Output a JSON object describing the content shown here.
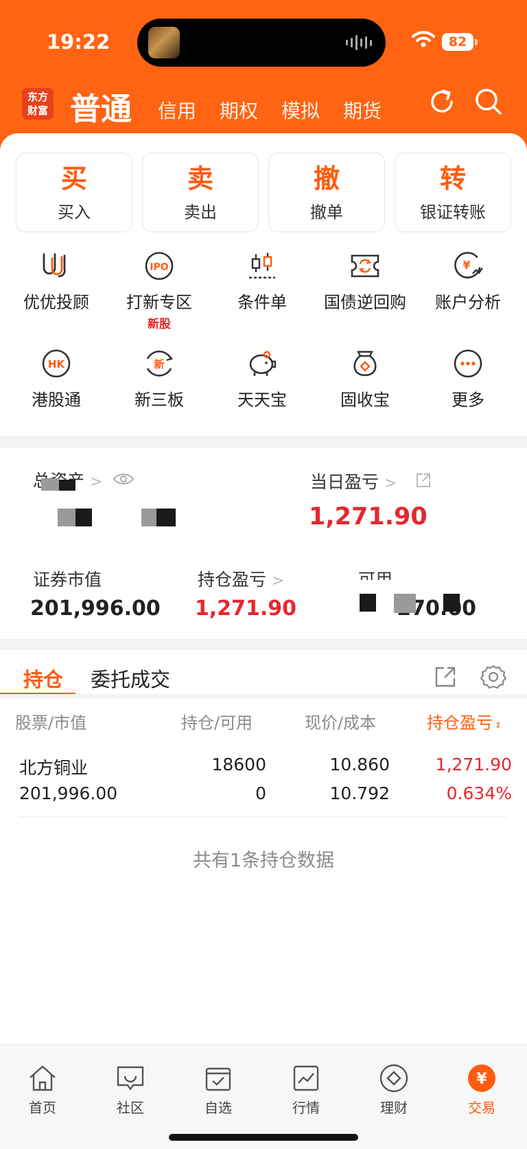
{
  "status": {
    "time": "19:22",
    "battery": "82"
  },
  "header": {
    "logo": [
      "东方",
      "财富"
    ],
    "active_tab": "普通",
    "tabs": [
      "信用",
      "期权",
      "模拟",
      "期货"
    ],
    "icons": [
      "refresh-icon",
      "search-icon"
    ]
  },
  "trade_buttons": [
    {
      "big": "买",
      "label": "买入"
    },
    {
      "big": "卖",
      "label": "卖出"
    },
    {
      "big": "撤",
      "label": "撤单"
    },
    {
      "big": "转",
      "label": "银证转账"
    }
  ],
  "grid_row1": [
    {
      "label": "优优投顾",
      "icon": "uu-advisor-icon"
    },
    {
      "label": "打新专区",
      "icon": "ipo-icon",
      "badge": "新股"
    },
    {
      "label": "条件单",
      "icon": "candlestick-icon"
    },
    {
      "label": "国债逆回购",
      "icon": "repo-ticket-icon"
    },
    {
      "label": "账户分析",
      "icon": "account-analysis-icon"
    }
  ],
  "grid_row2": [
    {
      "label": "港股通",
      "icon": "hk-icon"
    },
    {
      "label": "新三板",
      "icon": "new-board-icon"
    },
    {
      "label": "天天宝",
      "icon": "piggy-bank-icon"
    },
    {
      "label": "固收宝",
      "icon": "money-bag-icon"
    },
    {
      "label": "更多",
      "icon": "more-icon"
    }
  ],
  "assets": {
    "total_label": "总资产",
    "daily_pnl_label": "当日盈亏",
    "daily_pnl_value": "1,271.90",
    "market_value_label": "证券市值",
    "market_value": "201,996.00",
    "position_pnl_label": "持仓盈亏",
    "position_pnl_value": "1,271.90",
    "available_label": "可用",
    "available_tail": "0,270.00"
  },
  "positions": {
    "tabs": [
      "持仓",
      "委托成交"
    ],
    "columns": [
      "股票/市值",
      "持仓/可用",
      "现价/成本",
      "持仓盈亏"
    ],
    "rows": [
      {
        "name": "北方铜业",
        "market_value": "201,996.00",
        "qty": "18600",
        "available": "0",
        "price": "10.860",
        "cost": "10.792",
        "pnl": "1,271.90",
        "pnl_pct": "0.634%"
      }
    ],
    "footer": "共有1条持仓数据"
  },
  "bottom_nav": [
    {
      "label": "首页",
      "icon": "home-icon"
    },
    {
      "label": "社区",
      "icon": "community-icon"
    },
    {
      "label": "自选",
      "icon": "watchlist-icon"
    },
    {
      "label": "行情",
      "icon": "market-icon"
    },
    {
      "label": "理财",
      "icon": "wealth-icon"
    },
    {
      "label": "交易",
      "icon": "trade-icon",
      "active": true
    }
  ],
  "colors": {
    "brand": "#ff6413",
    "accent": "#ff5c10",
    "gain": "#e5282e"
  }
}
